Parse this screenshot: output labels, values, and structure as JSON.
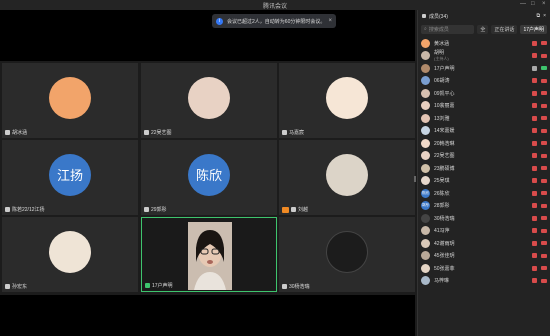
{
  "window": {
    "title": "腾讯会议",
    "controls": [
      "—",
      "□",
      "×"
    ]
  },
  "toast": {
    "text": "会议已超过2人，自动转为60分钟限时会议。",
    "info_glyph": "i",
    "close_glyph": "×"
  },
  "tiles": [
    {
      "name": "胡冰涵",
      "avatar_color": "#f2a46a"
    },
    {
      "name": "22吴艺图",
      "avatar_color": "#e8d2c4"
    },
    {
      "name": "马嘉宸",
      "avatar_color": "#f6e6d6"
    },
    {
      "name": "陈若22/12江扬",
      "avatar_text": "江扬"
    },
    {
      "name": "29郭彤",
      "avatar_text": "陈欣"
    },
    {
      "name": "刘越",
      "avatar_color": "#dcd4c8",
      "host": true
    },
    {
      "name": "孙宏东",
      "avatar_color": "#efe4d6"
    },
    {
      "name": "17户声明",
      "active": true
    },
    {
      "name": "30杨浩瑞",
      "avatar_color": "#1c1c1c"
    }
  ],
  "panel": {
    "header": "成员(34)",
    "search_placeholder": "搜索成员",
    "search_icon": "search-icon",
    "filter_all": "全",
    "filter_talking": "正在讲话",
    "filter_count": "17户声明"
  },
  "participants": [
    {
      "name": "黄冰涵",
      "sub": "",
      "color": "#f2a46a"
    },
    {
      "name": "胡明",
      "sub": "(主持人)",
      "color": "#c9b8a8"
    },
    {
      "name": "17户声明",
      "sub": "",
      "color": "#b08a6a"
    },
    {
      "name": "06胡涛",
      "sub": "",
      "color": "#7a9ed0"
    },
    {
      "name": "09凯平心",
      "sub": "",
      "color": "#d7c0b0"
    },
    {
      "name": "10裴丽嘉",
      "sub": "",
      "color": "#e8d0c0"
    },
    {
      "name": "13刘雅",
      "sub": "",
      "color": "#e2c3b2"
    },
    {
      "name": "14宋嘉媛",
      "sub": "",
      "color": "#c7d4e2"
    },
    {
      "name": "20韩浩琳",
      "sub": "",
      "color": "#f0d8c8"
    },
    {
      "name": "22吴艺图",
      "sub": "",
      "color": "#e8d2c4"
    },
    {
      "name": "23鹏硕博",
      "sub": "",
      "color": "#d0c0a8"
    },
    {
      "name": "25吴琪",
      "sub": "",
      "color": "#e6d8cc"
    },
    {
      "name": "26陈欣",
      "sub": "",
      "text": "陈欣"
    },
    {
      "name": "28郭彤",
      "sub": "",
      "text": "郭彤"
    },
    {
      "name": "30杨浩瑞",
      "sub": "",
      "color": "#444"
    },
    {
      "name": "41冯萍",
      "sub": "",
      "color": "#c8b8a8"
    },
    {
      "name": "42谢雨玥",
      "sub": "",
      "color": "#d8c8b8"
    },
    {
      "name": "45张佳玥",
      "sub": "",
      "color": "#b8a898"
    },
    {
      "name": "50张嘉菲",
      "sub": "",
      "color": "#e4d4c4"
    },
    {
      "name": "马梓琳",
      "sub": "",
      "color": "#a8b8c8"
    }
  ]
}
